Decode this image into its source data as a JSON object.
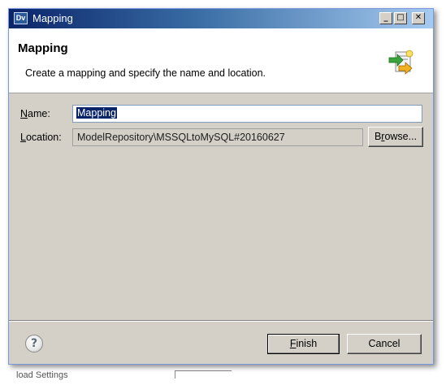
{
  "window": {
    "title": "Mapping",
    "app_icon_text": "Dv",
    "minimize_glyph": "_",
    "maximize_glyph": "□",
    "close_glyph": "✕"
  },
  "header": {
    "title": "Mapping",
    "description": "Create a mapping and specify the name and location.",
    "icon": "new-mapping-wizard-icon"
  },
  "form": {
    "name_label_mnemonic": "N",
    "name_label_rest": "ame:",
    "name_value": "Mapping",
    "location_label_mnemonic": "L",
    "location_label_rest": "ocation:",
    "location_value": "ModelRepository\\MSSQLtoMySQL#20160627",
    "browse_label_prefix": "B",
    "browse_label_mnemonic": "r",
    "browse_label_rest": "owse..."
  },
  "footer": {
    "help_glyph": "?",
    "finish_label_mnemonic": "F",
    "finish_label_rest": "inish",
    "cancel_label": "Cancel"
  },
  "background": {
    "partial_text": "load Settings"
  },
  "colors": {
    "title_gradient_start": "#0a246a",
    "title_gradient_end": "#a6caf0",
    "dialog_face": "#d4d0c8",
    "selection": "#0a246a"
  }
}
